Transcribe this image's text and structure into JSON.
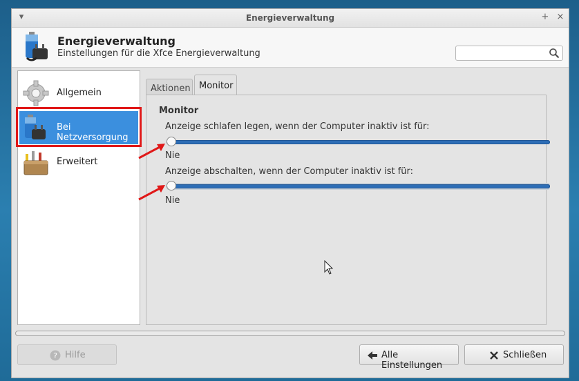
{
  "window": {
    "title": "Energieverwaltung",
    "controls": [
      "+",
      "×"
    ]
  },
  "header": {
    "title": "Energieverwaltung",
    "subtitle": "Einstellungen für die Xfce Energieverwaltung",
    "search": {
      "value": "",
      "placeholder": ""
    }
  },
  "sidebar": {
    "items": [
      {
        "label": "Allgemein",
        "icon": "gear-icon",
        "selected": false
      },
      {
        "label": "Bei Netzversorgung",
        "icon": "battery-plug-icon",
        "selected": true
      },
      {
        "label": "Erweitert",
        "icon": "toolbox-icon",
        "selected": false
      }
    ]
  },
  "tabs": [
    {
      "label": "Aktionen",
      "active": false
    },
    {
      "label": "Monitor",
      "active": true
    }
  ],
  "monitor": {
    "section_title": "Monitor",
    "sleep": {
      "label": "Anzeige schlafen legen, wenn der Computer inaktiv ist für:",
      "value_text": "Nie",
      "level": 0
    },
    "off": {
      "label": "Anzeige abschalten, wenn der Computer inaktiv ist für:",
      "value_text": "Nie",
      "level": 0
    }
  },
  "buttons": {
    "help": "Hilfe",
    "all_settings": "Alle Einstellungen",
    "close": "Schließen"
  },
  "colors": {
    "selection": "#3b8fde",
    "highlight_box": "#e01818",
    "slider_fill": "#2d6db5"
  }
}
